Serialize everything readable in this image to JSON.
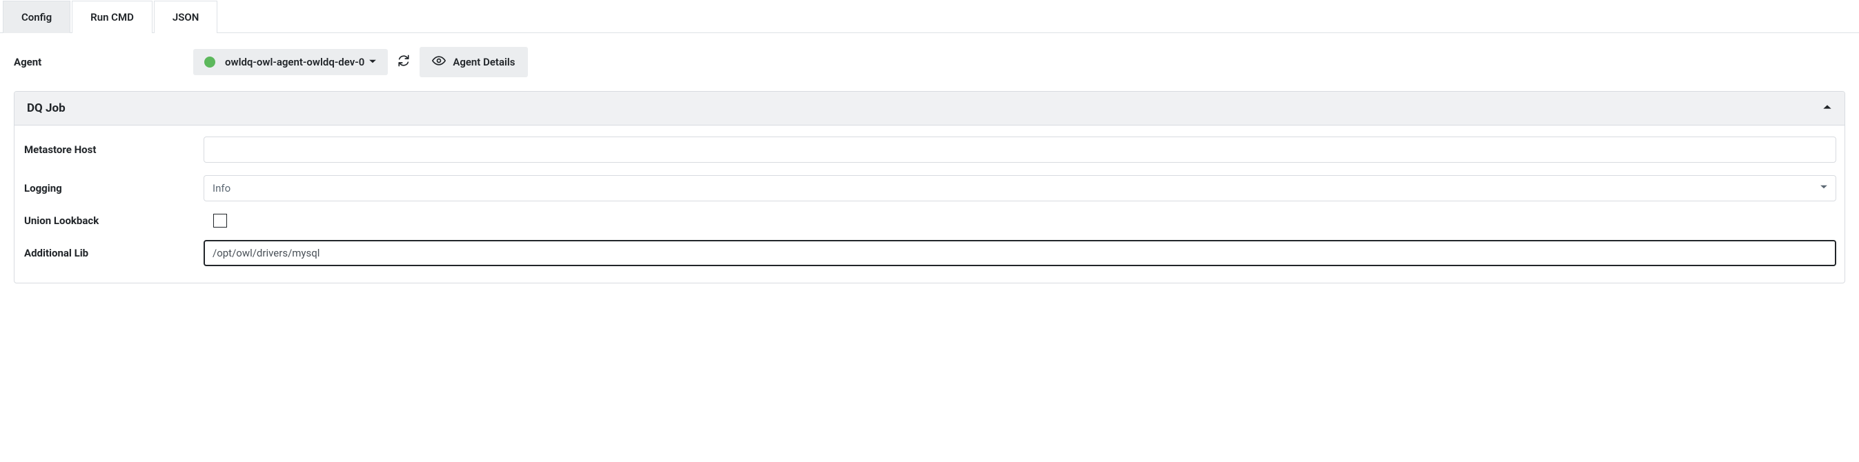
{
  "tabs": {
    "config": "Config",
    "run_cmd": "Run CMD",
    "json": "JSON"
  },
  "agent": {
    "label": "Agent",
    "selected": "owldq-owl-agent-owldq-dev-0",
    "details_label": "Agent Details"
  },
  "panel": {
    "title": "DQ Job",
    "fields": {
      "metastore_host": {
        "label": "Metastore Host",
        "value": ""
      },
      "logging": {
        "label": "Logging",
        "value": "Info"
      },
      "union_lookback": {
        "label": "Union Lookback",
        "checked": false
      },
      "additional_lib": {
        "label": "Additional Lib",
        "value": "/opt/owl/drivers/mysql"
      }
    }
  }
}
